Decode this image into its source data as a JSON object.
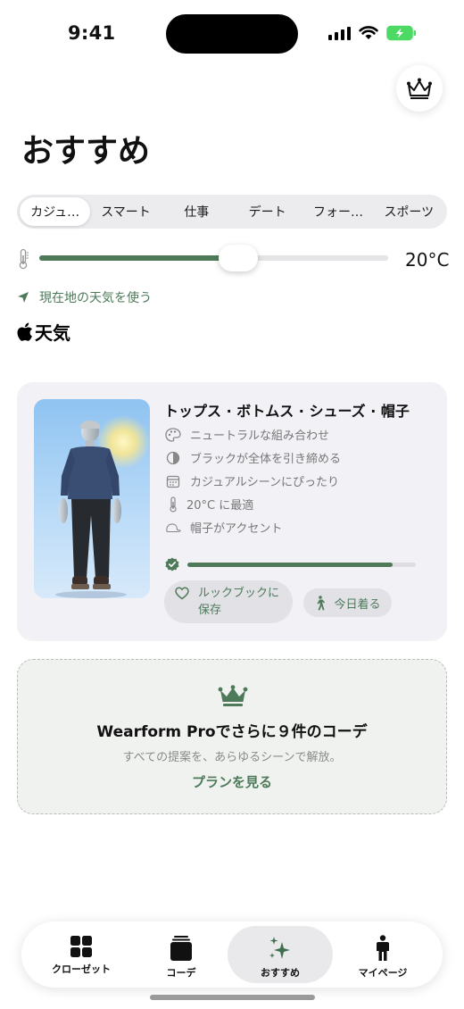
{
  "status_bar": {
    "time": "9:41"
  },
  "page": {
    "title": "おすすめ"
  },
  "segments": {
    "items": [
      "カジュ…",
      "スマート",
      "仕事",
      "デート",
      "フォー…",
      "スポーツ"
    ],
    "selected_index": 0
  },
  "temperature": {
    "value_label": "20°C",
    "slider_fraction": 0.57
  },
  "location": {
    "use_current_label": "現在地の天気を使う"
  },
  "weather_brand": {
    "label": "天気"
  },
  "outfit_card": {
    "title": "トップス · ボトムス · シューズ · 帽子",
    "features": [
      {
        "icon": "palette-icon",
        "text": "ニュートラルな組み合わせ"
      },
      {
        "icon": "contrast-icon",
        "text": "ブラックが全体を引き締める"
      },
      {
        "icon": "calendar-icon",
        "text": "カジュアルシーンにぴったり"
      },
      {
        "icon": "thermometer-icon",
        "text": "20°C に最適"
      },
      {
        "icon": "cap-icon",
        "text": "帽子がアクセント"
      }
    ],
    "match_fraction": 0.9,
    "save_button_label": "ルックブックに保存",
    "wear_button_label": "今日着る"
  },
  "pro_card": {
    "title": "Wearform Proでさらに９件のコーデ",
    "subtitle": "すべての提案を、あらゆるシーンで解放。",
    "link": "プランを見る"
  },
  "tab_bar": {
    "items": [
      {
        "label": "クローゼット",
        "icon": "grid-icon"
      },
      {
        "label": "コーデ",
        "icon": "stack-icon"
      },
      {
        "label": "おすすめ",
        "icon": "sparkles-icon"
      },
      {
        "label": "マイページ",
        "icon": "person-icon"
      }
    ],
    "selected_index": 2
  },
  "colors": {
    "accent": "#4e7a5a",
    "background": "#ffffff",
    "card": "#f2f2f6"
  }
}
